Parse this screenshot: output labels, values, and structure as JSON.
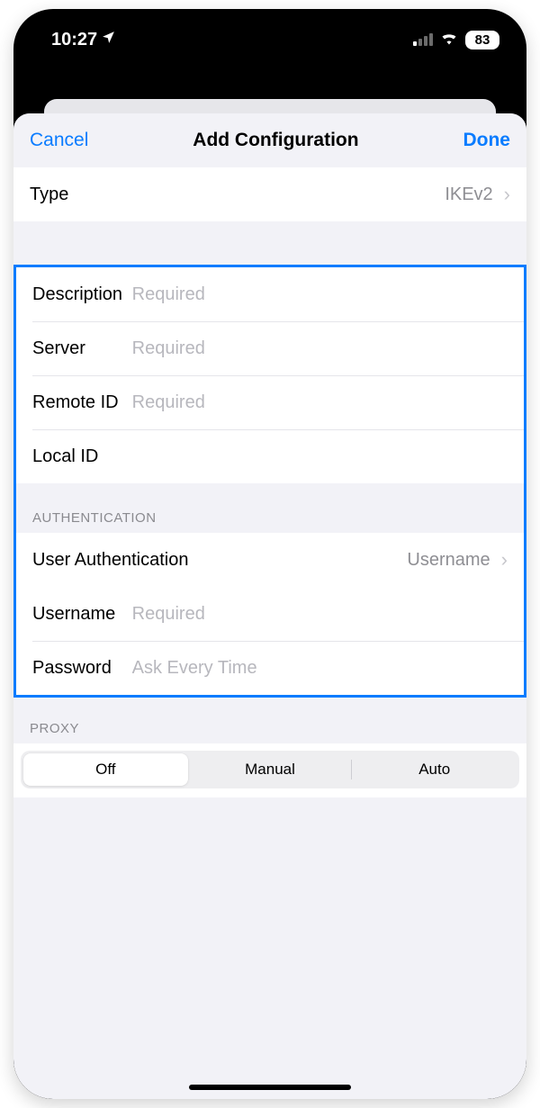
{
  "status": {
    "time": "10:27",
    "battery": "83"
  },
  "nav": {
    "cancel": "Cancel",
    "title": "Add Configuration",
    "done": "Done"
  },
  "type_row": {
    "label": "Type",
    "value": "IKEv2"
  },
  "conn": {
    "description": {
      "label": "Description",
      "placeholder": "Required",
      "value": ""
    },
    "server": {
      "label": "Server",
      "placeholder": "Required",
      "value": ""
    },
    "remote_id": {
      "label": "Remote ID",
      "placeholder": "Required",
      "value": ""
    },
    "local_id": {
      "label": "Local ID",
      "placeholder": "",
      "value": ""
    }
  },
  "auth": {
    "header": "AUTHENTICATION",
    "user_auth": {
      "label": "User Authentication",
      "value": "Username"
    },
    "username": {
      "label": "Username",
      "placeholder": "Required",
      "value": ""
    },
    "password": {
      "label": "Password",
      "placeholder": "Ask Every Time",
      "value": ""
    }
  },
  "proxy": {
    "header": "PROXY",
    "options": {
      "off": "Off",
      "manual": "Manual",
      "auto": "Auto"
    },
    "selected": "off"
  }
}
